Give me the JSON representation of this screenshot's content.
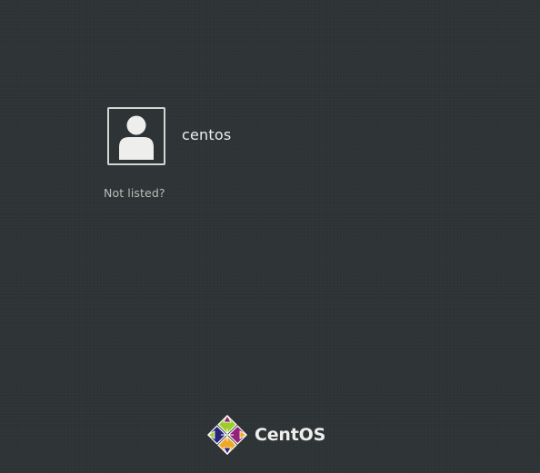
{
  "users": [
    {
      "name": "centos",
      "avatar_icon": "user-silhouette-icon"
    }
  ],
  "not_listed_label": "Not listed?",
  "branding": {
    "name": "CentOS",
    "logo_icon": "centos-logo-icon"
  },
  "colors": {
    "background": "#2e3436",
    "text": "#eeeeec",
    "muted_text": "#babdb6",
    "avatar_border": "#d3d7cf",
    "logo_green": "#9ccd2a",
    "logo_purple": "#932279",
    "logo_orange": "#efa724",
    "logo_blue": "#262577"
  }
}
